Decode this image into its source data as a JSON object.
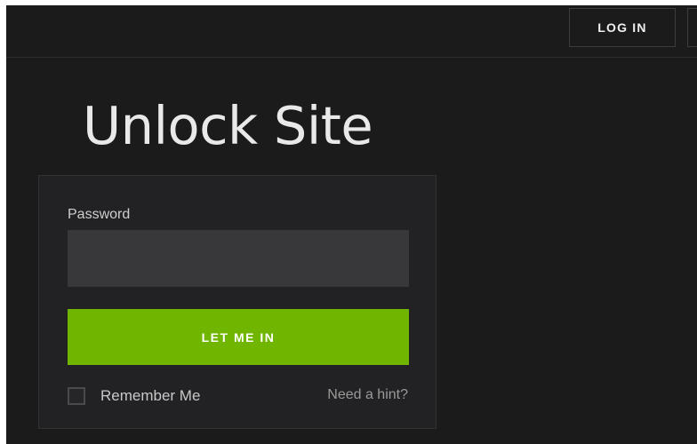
{
  "header": {
    "login_label": "LOG IN"
  },
  "page": {
    "title": "Unlock Site"
  },
  "form": {
    "password_label": "Password",
    "password_value": "",
    "submit_label": "LET ME IN",
    "remember_label": "Remember Me",
    "remember_checked": false,
    "hint_label": "Need a hint?"
  },
  "colors": {
    "background": "#1b1b1c",
    "card": "#222224",
    "input": "#38383b",
    "accent": "#70b500"
  }
}
